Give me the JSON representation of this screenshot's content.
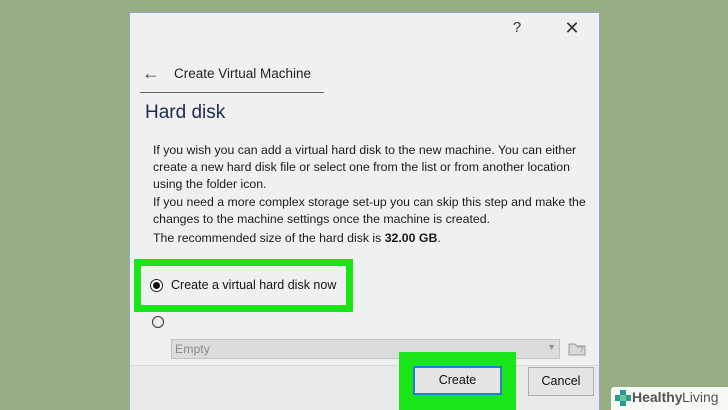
{
  "titlebar": {
    "help_label": "?",
    "close_label": "✕"
  },
  "wizard": {
    "back_icon": "arrow-left-icon",
    "title": "Create Virtual Machine"
  },
  "page": {
    "heading": "Hard disk",
    "para1": "If you wish you can add a virtual hard disk to the new machine. You can either create a new hard disk file or select one from the list or from another location using the folder icon.",
    "para2": "If you need a more complex storage set-up you can skip this step and make the changes to the machine settings once the machine is created.",
    "para3_prefix": "The recommended size of the hard disk is ",
    "para3_size": "32.00 GB",
    "para3_suffix": "."
  },
  "options": {
    "create_new": {
      "label": "Create a virtual hard disk now",
      "selected": true
    }
  },
  "existing_disk": {
    "selected_value": "Empty"
  },
  "buttons": {
    "create": "Create",
    "cancel": "Cancel"
  },
  "watermark": {
    "bold": "Healthy",
    "light": "Living"
  },
  "colors": {
    "background": "#97ad84",
    "highlight": "#19e619",
    "focus_border": "#2a7bd4"
  }
}
